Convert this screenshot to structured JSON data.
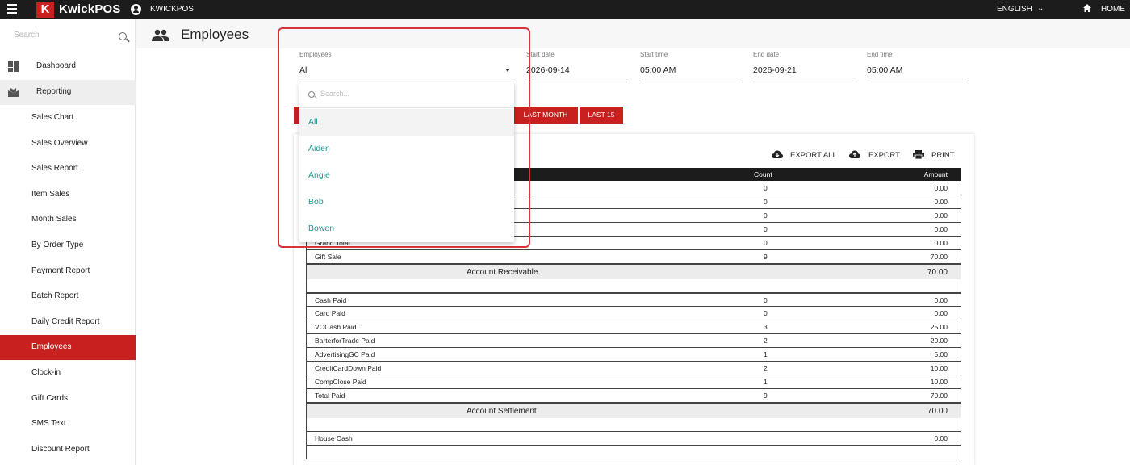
{
  "topbar": {
    "brand": "KwickPOS",
    "brand_letter": "K",
    "account": "KWICKPOS",
    "language": "ENGLISH",
    "home": "HOME"
  },
  "sidebar": {
    "search_placeholder": "Search",
    "items": [
      {
        "label": "Dashboard"
      },
      {
        "label": "Reporting"
      },
      {
        "label": "Sales Chart"
      },
      {
        "label": "Sales Overview"
      },
      {
        "label": "Sales Report"
      },
      {
        "label": "Item Sales"
      },
      {
        "label": "Month Sales"
      },
      {
        "label": "By Order Type"
      },
      {
        "label": "Payment Report"
      },
      {
        "label": "Batch Report"
      },
      {
        "label": "Daily Credit Report"
      },
      {
        "label": "Employees"
      },
      {
        "label": "Clock-in"
      },
      {
        "label": "Gift Cards"
      },
      {
        "label": "SMS Text"
      },
      {
        "label": "Discount Report"
      }
    ]
  },
  "page": {
    "title": "Employees"
  },
  "filters": {
    "employees": {
      "label": "Employees",
      "value": "All"
    },
    "start_date": {
      "label": "Start date",
      "value": "2026-09-14"
    },
    "start_time": {
      "label": "Start time",
      "value": "05:00 AM"
    },
    "end_date": {
      "label": "End date",
      "value": "2026-09-21"
    },
    "end_time": {
      "label": "End time",
      "value": "05:00 AM"
    }
  },
  "chips": {
    "last_month": "LAST MONTH",
    "last_15": "LAST 15"
  },
  "toolbar": {
    "export_all": "EXPORT ALL",
    "export": "EXPORT",
    "print": "PRINT"
  },
  "dropdown": {
    "search_placeholder": "Search...",
    "options": [
      "All",
      "Aiden",
      "Angie",
      "Bob",
      "Bowen"
    ]
  },
  "table": {
    "headers": {
      "count": "Count",
      "amount": "Amount"
    },
    "top_rows": [
      {
        "name": "",
        "count": "0",
        "amount": "0.00"
      },
      {
        "name": "",
        "count": "0",
        "amount": "0.00"
      },
      {
        "name": "",
        "count": "0",
        "amount": "0.00"
      },
      {
        "name": "",
        "count": "0",
        "amount": "0.00"
      },
      {
        "name": "Grand Total",
        "count": "0",
        "amount": "0.00"
      },
      {
        "name": "Gift Sale",
        "count": "9",
        "amount": "70.00"
      }
    ],
    "section1": {
      "title": "Account Receivable",
      "value": "70.00"
    },
    "paid_rows": [
      {
        "name": "Cash Paid",
        "count": "0",
        "amount": "0.00"
      },
      {
        "name": "Card Paid",
        "count": "0",
        "amount": "0.00"
      },
      {
        "name": "VOCash Paid",
        "count": "3",
        "amount": "25.00"
      },
      {
        "name": "BarterforTrade Paid",
        "count": "2",
        "amount": "20.00"
      },
      {
        "name": "AdvertisingGC Paid",
        "count": "1",
        "amount": "5.00"
      },
      {
        "name": "CreditCardDown Paid",
        "count": "2",
        "amount": "10.00"
      },
      {
        "name": "CompClose Paid",
        "count": "1",
        "amount": "10.00"
      },
      {
        "name": "Total Paid",
        "count": "9",
        "amount": "70.00"
      }
    ],
    "section2": {
      "title": "Account Settlement",
      "value": "70.00"
    },
    "house_row": {
      "name": "House Cash",
      "count": "",
      "amount": "0.00"
    }
  },
  "colors": {
    "brand": "#c8201f",
    "option_text": "#1a9a8f",
    "highlight": "#d6343a"
  }
}
